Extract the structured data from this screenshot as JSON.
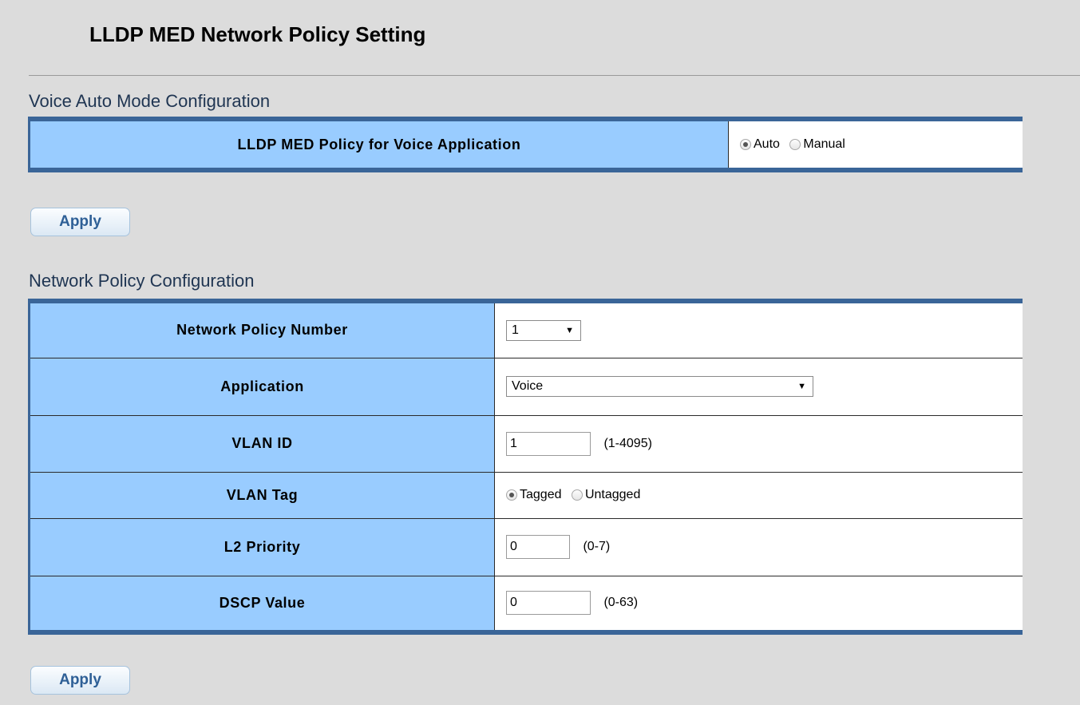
{
  "page": {
    "title": "LLDP MED Network Policy Setting"
  },
  "voice_auto": {
    "section_title": "Voice Auto Mode Configuration",
    "row_label": "LLDP MED Policy for Voice Application",
    "options": [
      {
        "label": "Auto",
        "checked": true
      },
      {
        "label": "Manual",
        "checked": false
      }
    ],
    "apply_label": "Apply"
  },
  "network_policy": {
    "section_title": "Network Policy Configuration",
    "rows": {
      "policy_number": {
        "label": "Network Policy Number",
        "value": "1"
      },
      "application": {
        "label": "Application",
        "value": "Voice"
      },
      "vlan_id": {
        "label": "VLAN ID",
        "value": "1",
        "hint": "(1-4095)"
      },
      "vlan_tag": {
        "label": "VLAN Tag",
        "options": [
          {
            "label": "Tagged",
            "checked": true
          },
          {
            "label": "Untagged",
            "checked": false
          }
        ]
      },
      "l2_priority": {
        "label": "L2 Priority",
        "value": "0",
        "hint": "(0-7)"
      },
      "dscp_value": {
        "label": "DSCP Value",
        "value": "0",
        "hint": "(0-63)"
      }
    },
    "apply_label": "Apply"
  },
  "colors": {
    "label_cell_bg": "#99ccff",
    "table_border_accent": "#3a6598",
    "page_bg": "#dcdcdc",
    "button_text": "#2e5f96"
  }
}
